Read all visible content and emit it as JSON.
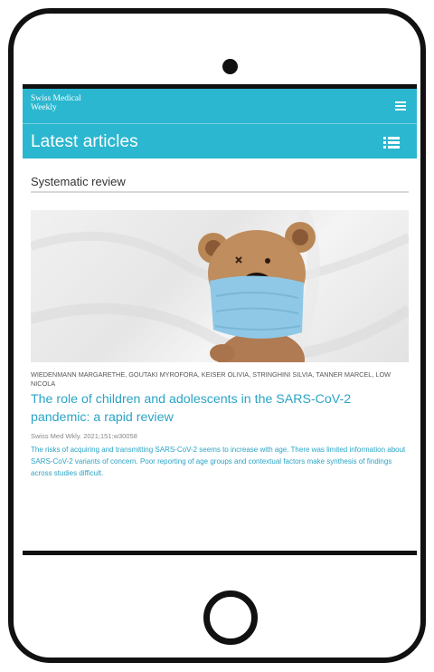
{
  "app": {
    "brand_line1": "Swiss Medical",
    "brand_line2": "Weekly"
  },
  "header": {
    "title": "Latest articles"
  },
  "section": {
    "label": "Systematic review"
  },
  "article": {
    "image_alt": "teddy bear wearing a blue surgical mask",
    "authors": "WIEDENMANN MARGARETHE, GOUTAKI MYROFORA, KEISER OLIVIA, STRINGHINI SILVIA, TANNER MARCEL, LOW NICOLA",
    "title": "The role of children and adolescents in the SARS-CoV-2 pandemic: a rapid review",
    "citation": "Swiss Med Wkly. 2021;151:w30058",
    "abstract": "The risks of acquiring and transmitting SARS-CoV-2 seems to increase with age. There was limited information about SARS-CoV-2 variants of concern. Poor reporting of age groups and contextual factors make synthesis of findings across studies difficult."
  },
  "icons": {
    "menu": "hamburger-menu-icon",
    "list": "list-view-icon"
  },
  "colors": {
    "accent": "#2bb7cf",
    "link": "#2aa4c6",
    "mask": "#8fc8e6",
    "bear": "#b8845a"
  }
}
